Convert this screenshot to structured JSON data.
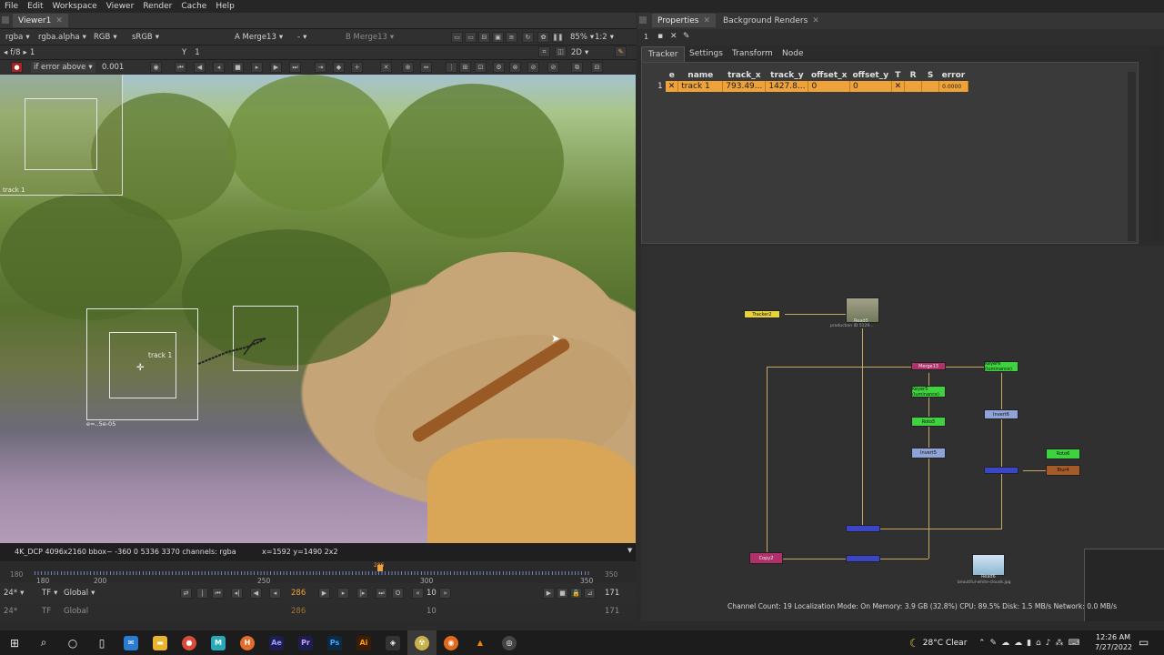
{
  "menu": [
    "File",
    "Edit",
    "Workspace",
    "Viewer",
    "Render",
    "Cache",
    "Help"
  ],
  "viewer_tab": {
    "label": "Viewer1"
  },
  "viewer_toolbar": {
    "channels": "rgba",
    "alpha": "rgba.alpha",
    "colorspace_mode": "RGB",
    "colorspace": "sRGB",
    "a_input": "A  Merge13",
    "composite": "-",
    "b_input": "B  Merge13",
    "zoom": "85%",
    "proxy": "1:2",
    "view_mode": "2D"
  },
  "viewer_toolbar2": {
    "fstop": "f/8",
    "frame_step": "1",
    "y_label": "Y",
    "y_value": "1"
  },
  "tracker_toolbar": {
    "error_mode": "if error above",
    "error_value": "0.001"
  },
  "overlays": {
    "track_label_small": "track 1",
    "track_label_main": "track 1",
    "error_readout": "e=..5e-05"
  },
  "info_bar": {
    "format": "4K_DCP 4096x2160  bbox~ -360 0 5336 3370 channels: rgba",
    "cursor": "x=1592 y=1490 2x2"
  },
  "timeline": {
    "ticks": [
      "180",
      "200",
      "250",
      "300",
      "350"
    ],
    "left_marker": "180",
    "right_marker": "350",
    "current_marker": "286"
  },
  "transport": {
    "fps": "24*",
    "tf": "TF",
    "scope": "Global",
    "current_frame": "286",
    "increment": "10",
    "end_frame": "171"
  },
  "properties_tabs": [
    "Properties",
    "Background Renders"
  ],
  "properties_counter": "1",
  "tracker_tabs": [
    "Tracker",
    "Settings",
    "Transform",
    "Node"
  ],
  "tracks_table": {
    "columns": [
      "e",
      "name",
      "track_x",
      "track_y",
      "offset_x",
      "offset_y",
      "T",
      "R",
      "S",
      "error"
    ],
    "rows": [
      {
        "index": "1",
        "e": "✕",
        "name": "track 1",
        "track_x": "793.49...",
        "track_y": "1427.8...",
        "offset_x": "0",
        "offset_y": "0",
        "T": "✕",
        "R": "",
        "S": "",
        "error": "0.0000"
      }
    ]
  },
  "nodes": {
    "tracker": "Tracker2",
    "read5": "Read5",
    "read5_file": "production ID 5129...",
    "merge": "Merge13",
    "keyer5": "Keyer5 (luminance)",
    "keyer6": "Keyer6 (luminance)",
    "roto5": "Roto5",
    "invert5": "Invert5",
    "invert6": "Invert6",
    "roto6": "Roto6",
    "blur4": "Blur4",
    "copy": "Copy2",
    "read6": "Read6",
    "read6_file": "beautiful-white-clouds.jpg"
  },
  "status_line": "Channel Count: 19  Localization Mode: On  Memory: 3.9 GB (32.8%) CPU: 89.5%  Disk: 1.5 MB/s  Network: 0.0 MB/s",
  "taskbar": {
    "apps": [
      "start",
      "search",
      "cortana",
      "task-view",
      "mail",
      "explorer",
      "chrome",
      "maya",
      "houdini",
      "after-effects",
      "premiere",
      "photoshop",
      "illustrator",
      "unity",
      "nuke",
      "firefox",
      "vlc",
      "obs"
    ],
    "weather": "28°C  Clear",
    "time": "12:26 AM",
    "date": "7/27/2022"
  },
  "colors": {
    "accent": "#f0a23a",
    "node_green": "#3fd23f",
    "node_magenta": "#b0306a",
    "node_blue": "#3a45c8",
    "node_yellow": "#e8d23a"
  }
}
